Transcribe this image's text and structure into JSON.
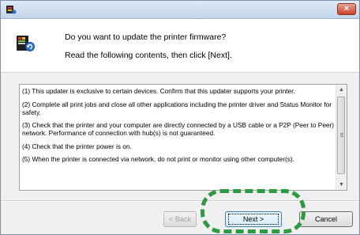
{
  "window": {
    "close_label": "×"
  },
  "header": {
    "question": "Do you want to update the printer firmware?",
    "instruction": "Read the following contents, then click [Next]."
  },
  "notice": {
    "items": [
      "(1) This updater is exclusive to certain devices. Confirm that this updater supports your printer.",
      "(2) Complete all print jobs and close all other applications including the printer driver and Status Monitor for safety.",
      "(3) Check that the printer and your computer are directly connected by a USB cable or a P2P (Peer to Peer) network. Performance of connection with hub(s) is not guaranteed.",
      "(4) Check that the printer power is on.",
      "(5) When the printer is connected via network,  do not print or monitor using other computer(s)."
    ]
  },
  "buttons": {
    "back_label": "< Back",
    "next_label": "Next >",
    "cancel_label": "Cancel"
  },
  "colors": {
    "highlight": "#2e9a44"
  }
}
